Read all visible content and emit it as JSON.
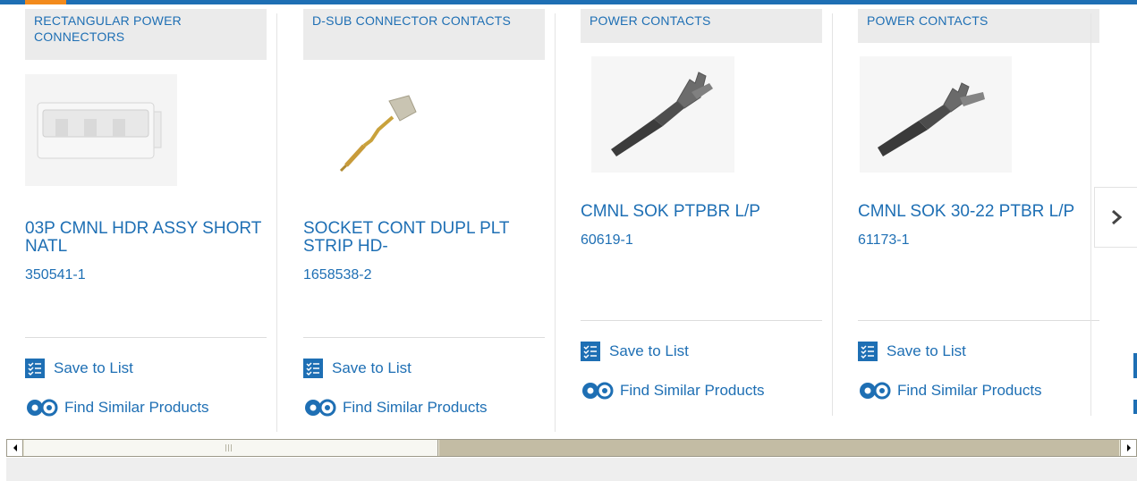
{
  "colors": {
    "brand_blue": "#1e6fb4",
    "accent_orange": "#f28a1c",
    "category_bg": "#ebebeb"
  },
  "cards": [
    {
      "category": "RECTANGULAR POWER CONNECTORS",
      "title": "03P CMNL HDR ASSY SHORT NATL",
      "part_number": "350541-1",
      "image_icon": "rectangular-connector-image",
      "save_label": "Save to List",
      "find_label": "Find Similar Products"
    },
    {
      "category": "D-SUB CONNECTOR CONTACTS",
      "title": "SOCKET CONT DUPL PLT STRIP HD-",
      "part_number": "1658538-2",
      "image_icon": "socket-contact-image",
      "save_label": "Save to List",
      "find_label": "Find Similar Products"
    },
    {
      "category": "POWER CONTACTS",
      "title": "CMNL SOK PTPBR L/P",
      "part_number": "60619-1",
      "image_icon": "power-contact-image",
      "save_label": "Save to List",
      "find_label": "Find Similar Products"
    },
    {
      "category": "POWER CONTACTS",
      "title": "CMNL SOK 30-22 PTBR L/P",
      "part_number": "61173-1",
      "image_icon": "power-contact-image",
      "save_label": "Save to List",
      "find_label": "Find Similar Products"
    }
  ],
  "carousel": {
    "next_icon": "chevron-right-icon"
  },
  "scrollbar": {
    "left_icon": "arrow-left-icon",
    "right_icon": "arrow-right-icon"
  }
}
